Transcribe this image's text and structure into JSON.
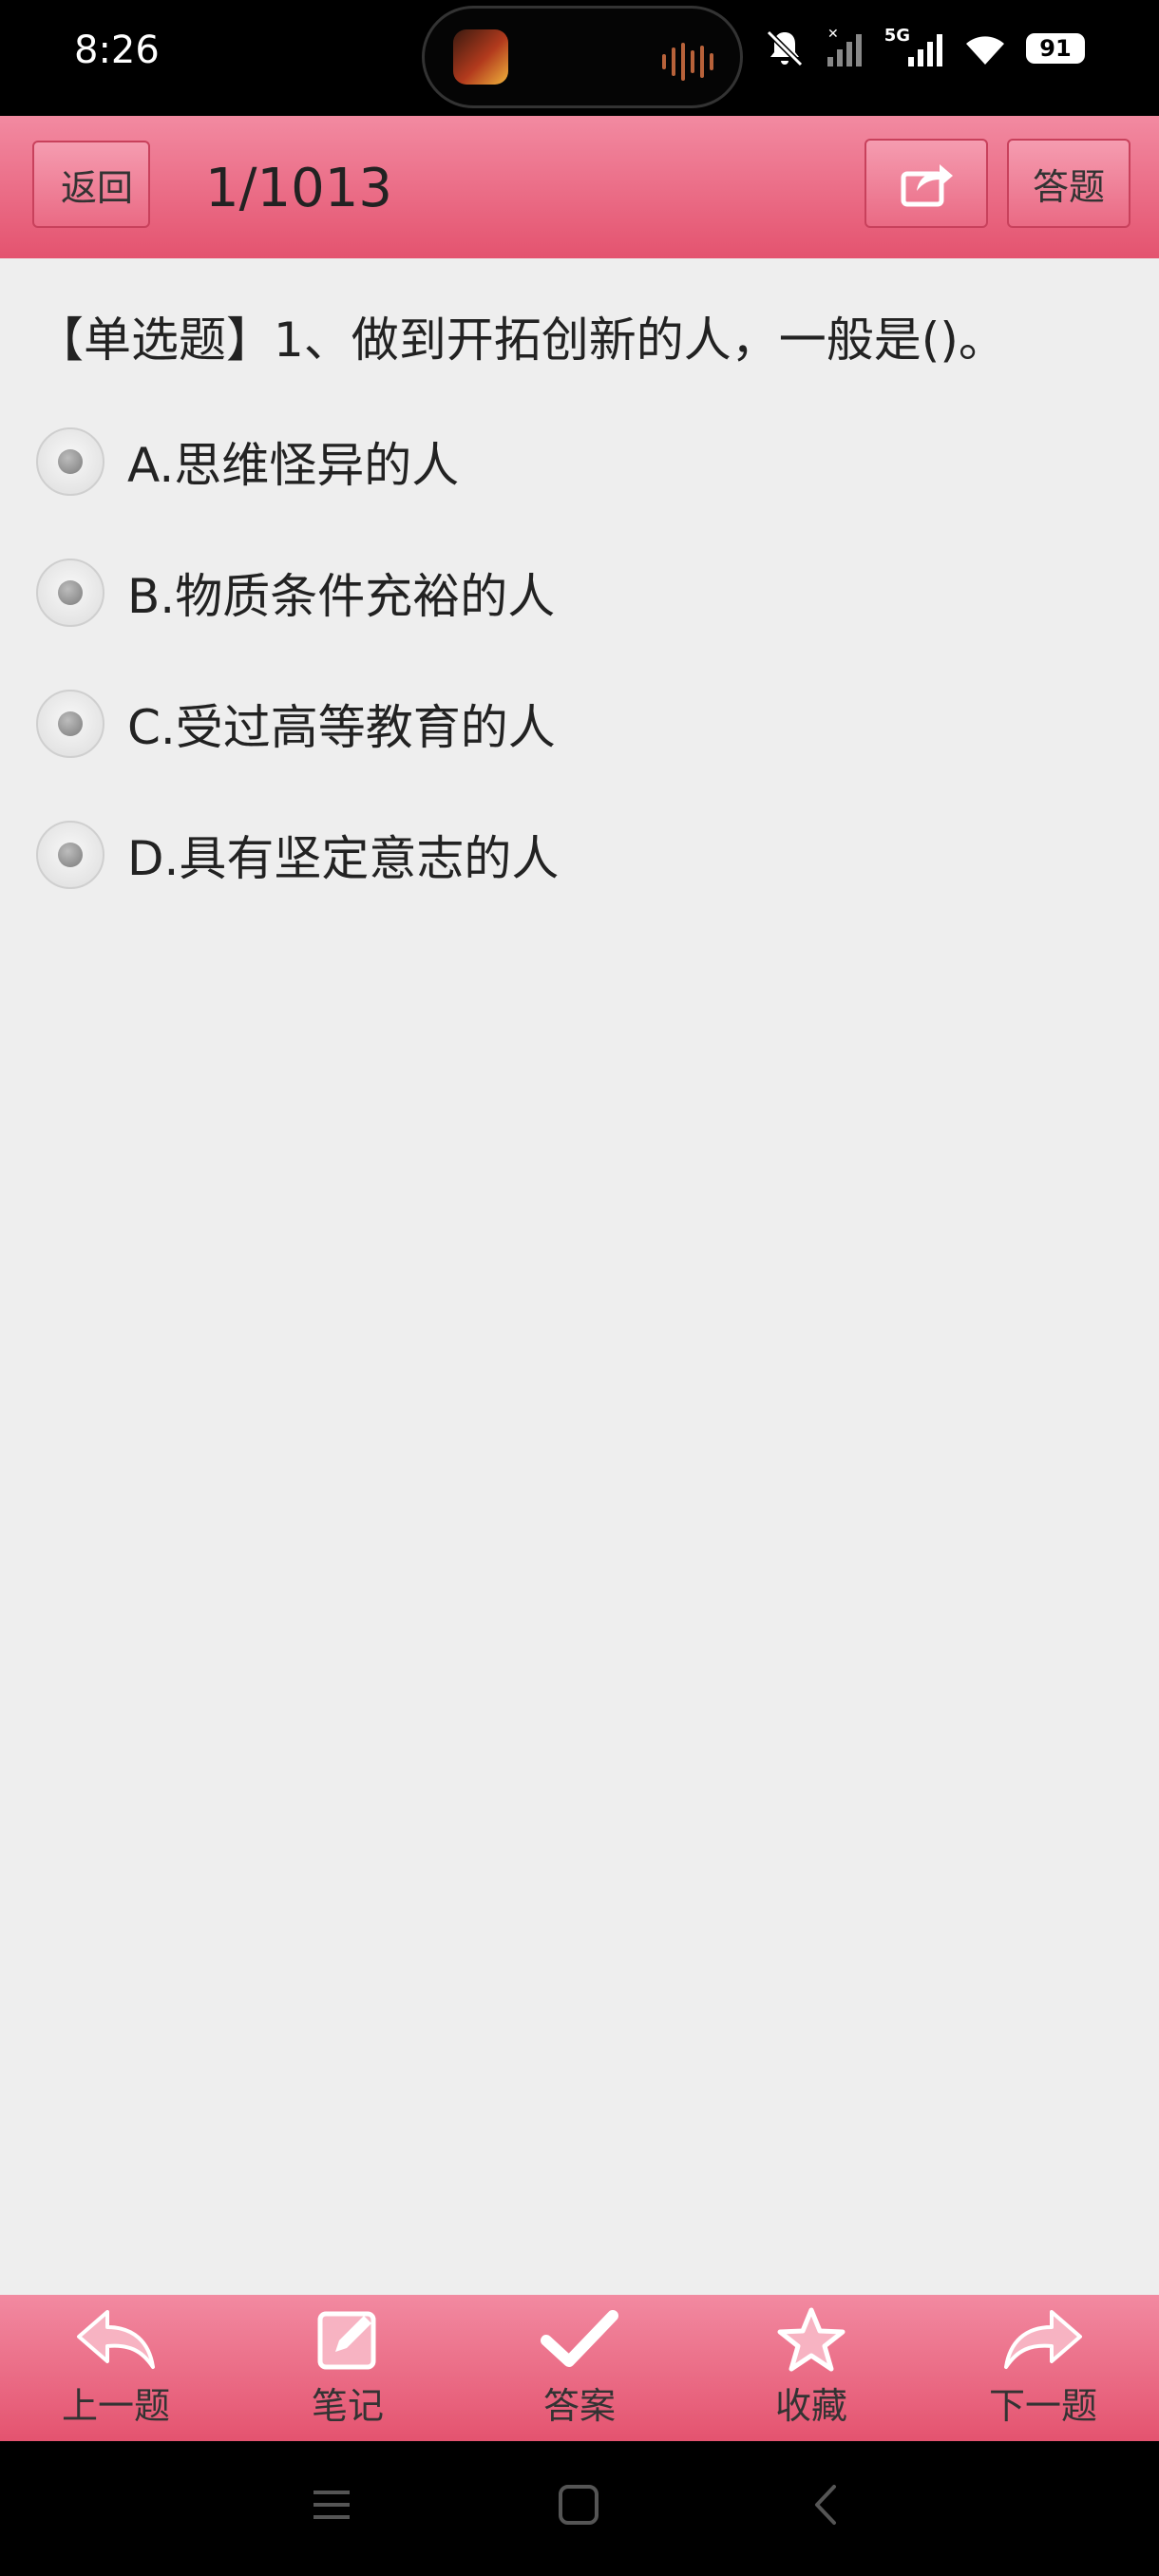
{
  "status_bar": {
    "time": "8:26",
    "network": "5G",
    "battery": "91"
  },
  "header": {
    "back_label": "返回",
    "counter": "1/1013",
    "answer_button": "答题"
  },
  "question": {
    "text": "【单选题】1、做到开拓创新的人，一般是()。",
    "options": [
      {
        "label": "A.思维怪异的人"
      },
      {
        "label": "B.物质条件充裕的人"
      },
      {
        "label": "C.受过高等教育的人"
      },
      {
        "label": "D.具有坚定意志的人"
      }
    ]
  },
  "toolbar": {
    "prev": "上一题",
    "note": "笔记",
    "answer": "答案",
    "favorite": "收藏",
    "next": "下一题"
  },
  "colors": {
    "accent": "#e4536f",
    "accent_light": "#f28aa1",
    "background": "#eeeeee"
  }
}
